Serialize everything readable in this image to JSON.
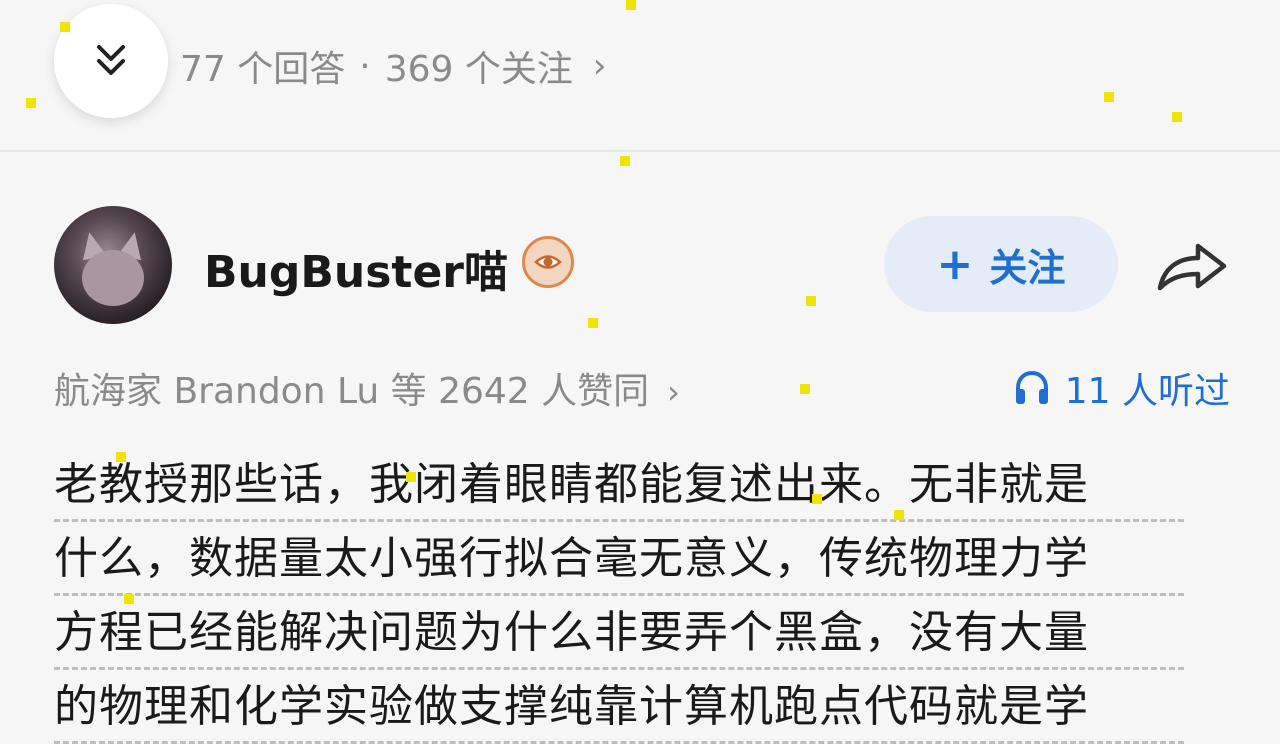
{
  "header": {
    "stats_text": "77 个回答 · 369 个关注",
    "answers": "77 个回答",
    "separator": "·",
    "followers": "369 个关注",
    "chevron": "›"
  },
  "author": {
    "name": "BugBuster喵",
    "follow_label": "+ 关注",
    "follow_plus": "+",
    "follow_text": "关注"
  },
  "meta": {
    "upvote_text": "航海家 Brandon Lu 等 2642 人赞同",
    "upvote_chevron": "›",
    "listeners_text": "11 人听过"
  },
  "answer": {
    "lines": [
      "老教授那些话，我闭着眼睛都能复述出来。无非就是",
      "什么，数据量太小强行拟合毫无意义，传统物理力学",
      "方程已经能解决问题为什么非要弄个黑盒，没有大量",
      "的物理和化学实验做支撑纯靠计算机跑点代码就是学"
    ]
  },
  "colors": {
    "accent": "#1f6fd1",
    "follow_bg": "#e4ecf7",
    "muted_text": "#8a8a8a",
    "badge_orange": "#e0874a"
  },
  "icons": {
    "collapse": "double-chevron-down-icon",
    "badge": "eye-badge-icon",
    "share": "share-arrow-icon",
    "listen": "headphones-icon"
  }
}
